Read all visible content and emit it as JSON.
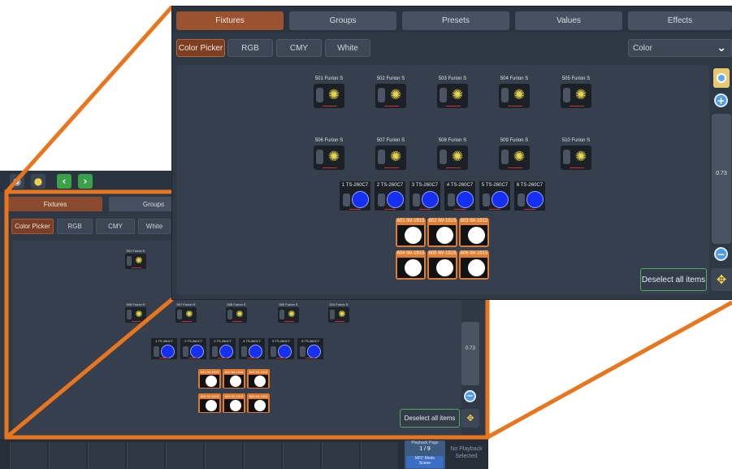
{
  "toolbar": {
    "icons": [
      "eye-icon",
      "bulb-icon",
      "arrow-left-icon",
      "arrow-right-icon"
    ]
  },
  "tabs": [
    "Fixtures",
    "Groups",
    "Presets",
    "Values",
    "Effects"
  ],
  "subtabs": [
    "Color Picker",
    "RGB",
    "CMY",
    "White"
  ],
  "dropdown": {
    "value": "Color"
  },
  "fixtures_row1": [
    "501 Furion S",
    "502 Furion S",
    "503 Furion S",
    "504 Furion S",
    "505 Furion S"
  ],
  "fixtures_row2": [
    "506 Furion S",
    "507 Furion S",
    "508 Furion S",
    "509 Furion S",
    "510 Furion S"
  ],
  "ts_fixtures": [
    "1 TS-260C7",
    "2 TS-260C7",
    "3 TS-260C7",
    "4 TS-260C7",
    "5 TS-260C7",
    "6 TS-260C7"
  ],
  "iw_row1": [
    "601 iW-1915",
    "602 iW-1915",
    "603 iW-1915"
  ],
  "iw_row2": [
    "604 iW-1915",
    "605 iW-1915",
    "606 iW-1915"
  ],
  "zoom_value": "0.73",
  "deselect_label": "Deselect all items",
  "playback": {
    "title": "Playback Page",
    "page": "1 / 9",
    "mode_title": "MFF Mode",
    "mode_value": "Scene",
    "none_text": "No Playback Selected"
  },
  "colors": {
    "accent": "#e07c2d",
    "active_tab": "#9b532f",
    "panel": "#2f3845"
  }
}
